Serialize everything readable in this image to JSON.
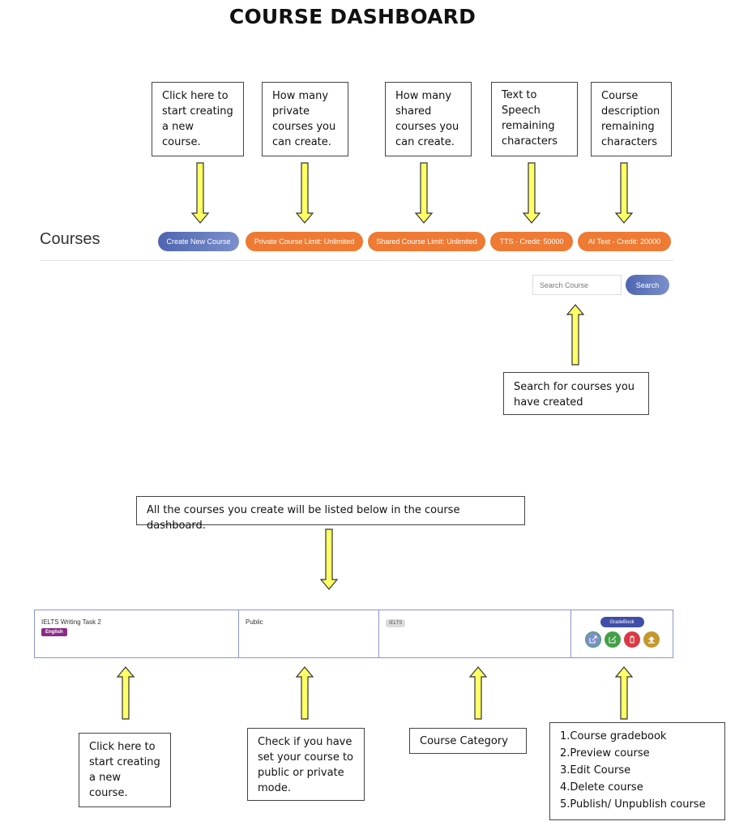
{
  "page_title": "COURSE DASHBOARD",
  "top_callouts": [
    "Click here to\nstart creating\na new course.",
    "How many\nprivate\ncourses  you\ncan create.",
    "How many\nshared\ncourses  you\ncan create.",
    "Text to\nSpeech\nremaining\ncharacters",
    "Course\ndescription\nremaining\ncharacters"
  ],
  "header": {
    "title": "Courses",
    "create_button": "Create New Course",
    "private_limit": "Private Course Limit: Unlimited",
    "shared_limit": "Shared Course Limit: Unlimited",
    "tts_credit": "TTS - Credit: 50000",
    "ai_text_credit": "AI Text - Credit: 20000"
  },
  "search": {
    "placeholder": "Search Course",
    "button_label": "Search",
    "callout": "Search for courses you\nhave created"
  },
  "list_callout": "All the courses you create will be listed below in the course dashboard.",
  "course_row": {
    "name": "IELTS Writing Task 2",
    "language": "English",
    "visibility": "Public",
    "category": "IELTS",
    "gradebook_label": "GradeBook",
    "actions": [
      "preview",
      "edit",
      "delete",
      "publish"
    ]
  },
  "bottom_callouts": {
    "name": "Click here to\nstart creating\na new course.",
    "visibility": "Check if you have\nset your course to\npublic or private\nmode.",
    "category": "Course Category",
    "actions": "1.Course gradebook\n2.Preview course\n3.Edit Course\n4.Delete course\n5.Publish/ Unpublish course"
  },
  "colors": {
    "arrow_fill": "#ffff66",
    "primary_blue": "#4e65b0",
    "orange": "#ee7a33",
    "language_badge": "#8a2c87"
  }
}
